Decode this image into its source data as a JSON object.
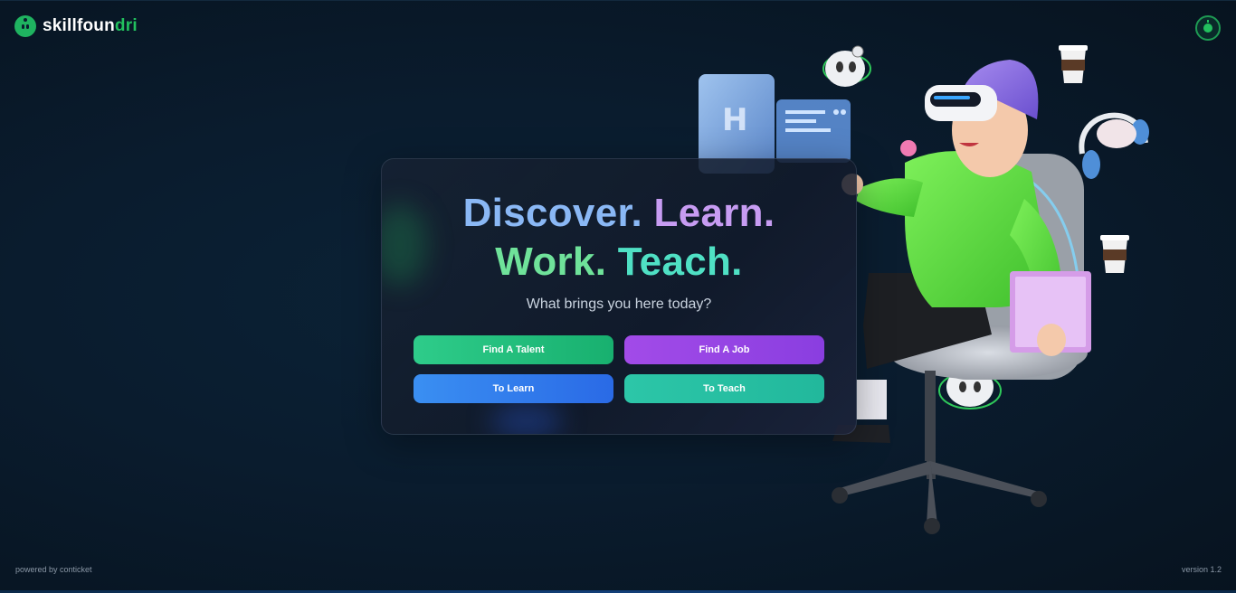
{
  "brand": {
    "name_part1": "skillfoun",
    "name_part2": "dri"
  },
  "hero": {
    "line1": {
      "word1": "Discover.",
      "word2": "Learn."
    },
    "line2": {
      "word1": "Work.",
      "word2": "Teach."
    },
    "subtitle": "What brings you here today?"
  },
  "actions": {
    "find_talent": "Find A Talent",
    "find_job": "Find A Job",
    "to_learn": "To Learn",
    "to_teach": "To Teach"
  },
  "footer": {
    "powered_by": "powered by conticket",
    "version": "version 1.2"
  },
  "colors": {
    "brand_green": "#22c05e",
    "discover": "#8ab8f5",
    "learn": "#c79cf2",
    "work": "#6fe29a",
    "teach": "#4fe0c4",
    "talent_button": "#1fbf7c",
    "job_button": "#9445e4",
    "learn_button": "#3280ec",
    "teach_button": "#27bfa2"
  },
  "icons": [
    "skillfoundri-logo-icon",
    "user-avatar-icon"
  ]
}
